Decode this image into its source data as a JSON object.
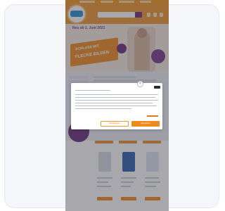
{
  "site": {
    "banner_heading": "Neu ab 1. Juni 2021",
    "ribbon_line1": "SCHLUSS MIT",
    "ribbon_line2": "FLECKE BILDEN"
  },
  "cookie_modal": {
    "close_glyph": "×",
    "settings_label": "Einstellungen",
    "accept_label": "Akzeptieren"
  },
  "colors": {
    "brand_orange": "#f0962a",
    "brand_purple": "#6a2c7d",
    "card_background": "#f4f6fa"
  }
}
